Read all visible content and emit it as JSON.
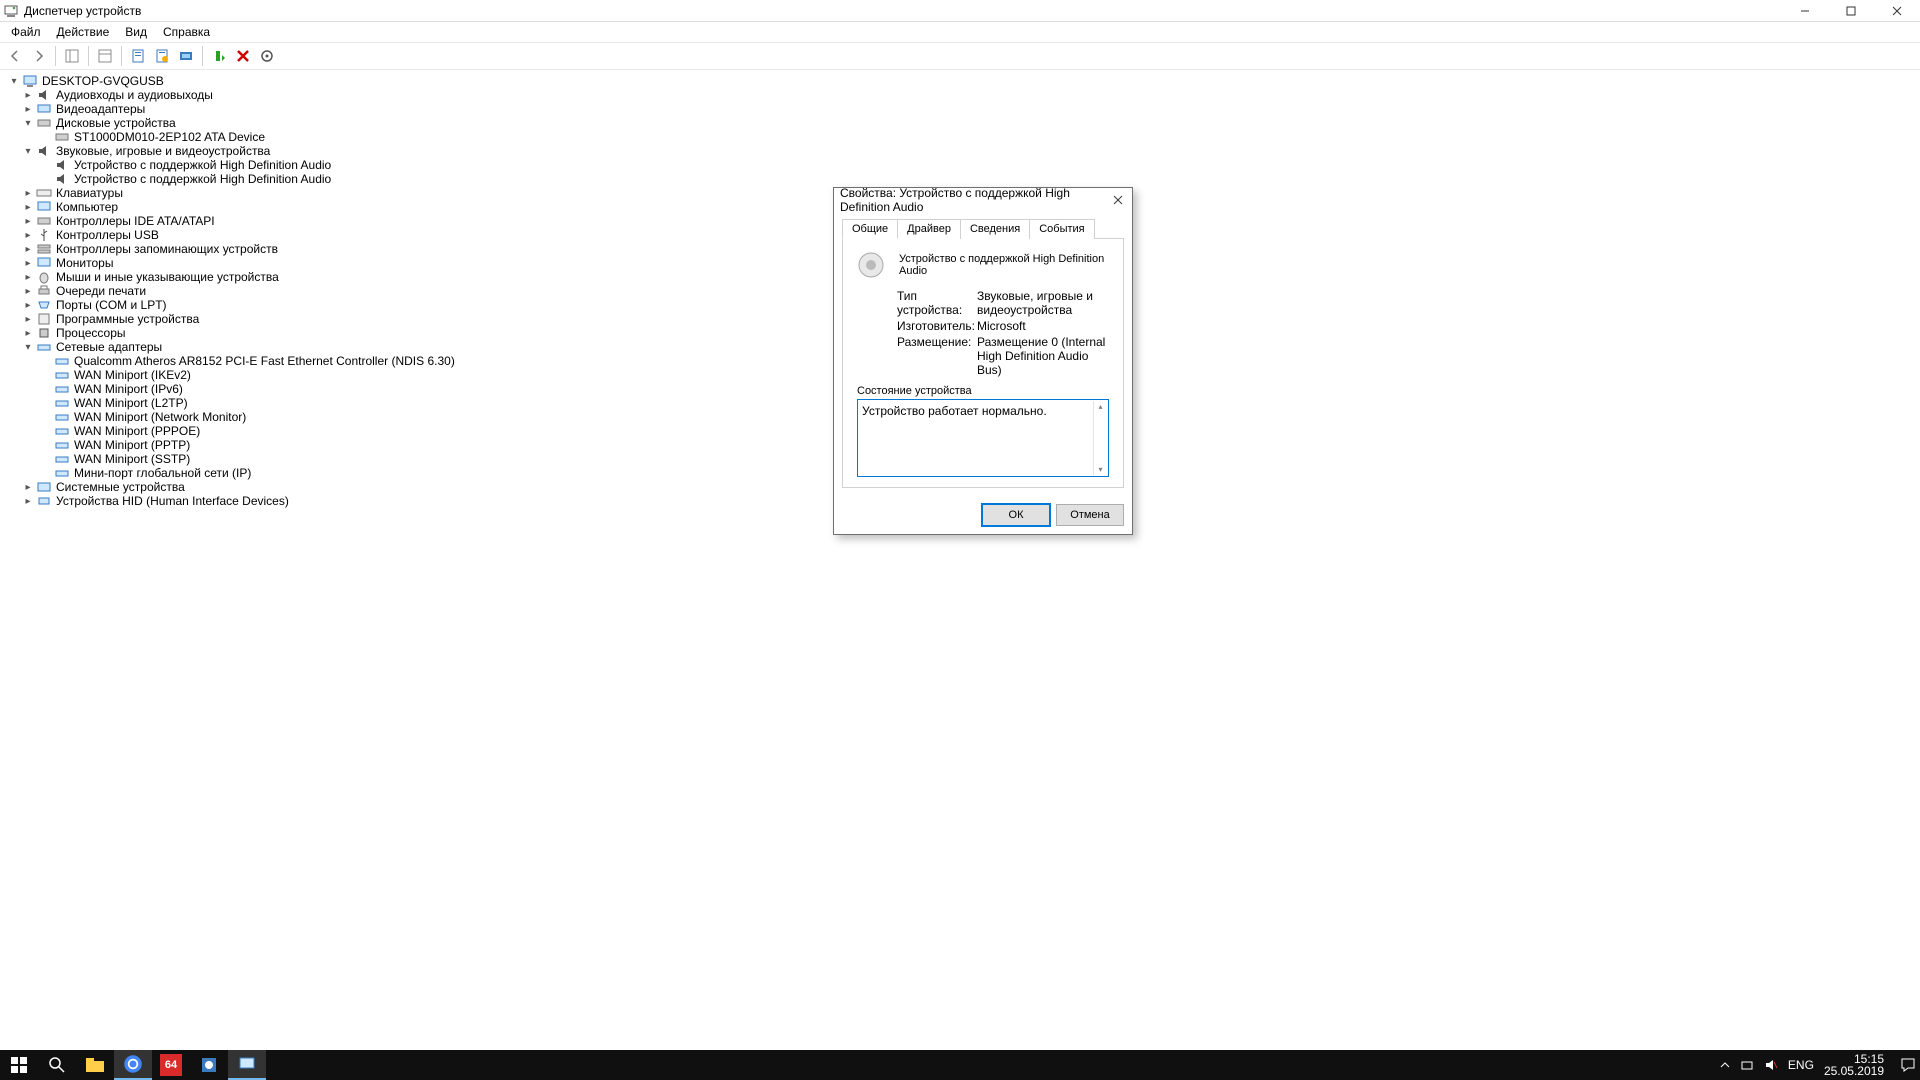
{
  "window": {
    "title": "Диспетчер устройств"
  },
  "menu": {
    "file": "Файл",
    "action": "Действие",
    "view": "Вид",
    "help": "Справка"
  },
  "tree": {
    "root": "DESKTOP-GVQGUSB",
    "cat": {
      "audio": "Аудиовходы и аудиовыходы",
      "video": "Видеоадаптеры",
      "disk": "Дисковые устройства",
      "disk_item": "ST1000DM010-2EP102 ATA Device",
      "sound": "Звуковые, игровые и видеоустройства",
      "sound_item1": "Устройство с поддержкой High Definition Audio",
      "sound_item2": "Устройство с поддержкой High Definition Audio",
      "keyboard": "Клавиатуры",
      "computer": "Компьютер",
      "ide": "Контроллеры IDE ATA/ATAPI",
      "usb": "Контроллеры USB",
      "storage": "Контроллеры запоминающих устройств",
      "monitors": "Мониторы",
      "mice": "Мыши и иные указывающие устройства",
      "printq": "Очереди печати",
      "ports": "Порты (COM и LPT)",
      "software": "Программные устройства",
      "cpu": "Процессоры",
      "net": "Сетевые адаптеры",
      "net_items": [
        "Qualcomm Atheros AR8152 PCI-E Fast Ethernet Controller (NDIS 6.30)",
        "WAN Miniport (IKEv2)",
        "WAN Miniport (IPv6)",
        "WAN Miniport (L2TP)",
        "WAN Miniport (Network Monitor)",
        "WAN Miniport (PPPOE)",
        "WAN Miniport (PPTP)",
        "WAN Miniport (SSTP)",
        "Мини-порт глобальной сети (IP)"
      ],
      "system": "Системные устройства",
      "hid": "Устройства HID (Human Interface Devices)"
    }
  },
  "dialog": {
    "title": "Свойства: Устройство с поддержкой High Definition Audio",
    "tabs": {
      "general": "Общие",
      "driver": "Драйвер",
      "details": "Сведения",
      "events": "События"
    },
    "device_name": "Устройство с поддержкой High Definition Audio",
    "type_label": "Тип устройства:",
    "type_value": "Звуковые, игровые и видеоустройства",
    "vendor_label": "Изготовитель:",
    "vendor_value": "Microsoft",
    "location_label": "Размещение:",
    "location_value": "Размещение 0 (Internal High Definition Audio Bus)",
    "status_group": "Состояние устройства",
    "status_text": "Устройство работает нормально.",
    "ok": "ОК",
    "cancel": "Отмена"
  },
  "taskbar": {
    "lang": "ENG",
    "time": "15:15",
    "date": "25.05.2019",
    "aida": "64"
  }
}
